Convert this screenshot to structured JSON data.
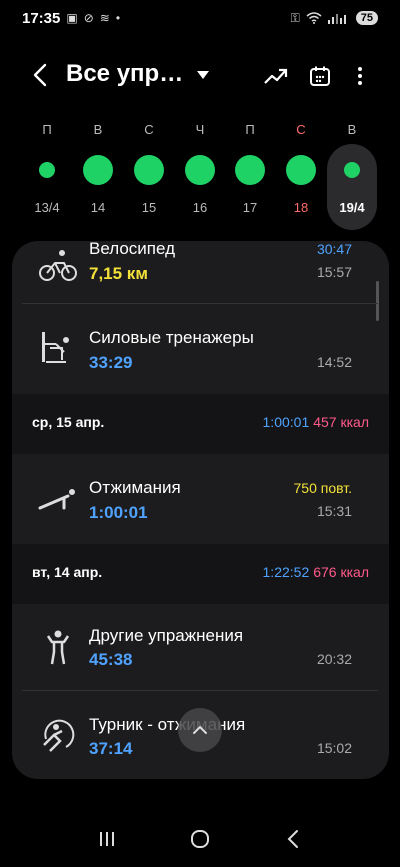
{
  "status": {
    "time": "17:35",
    "battery": "75",
    "icons": [
      "screenshot-icon",
      "link-icon",
      "wavy-icon",
      "dot-icon",
      "key-icon",
      "wifi-icon",
      "signal-icon"
    ]
  },
  "header": {
    "title": "Все упр…",
    "icons": [
      "back-icon",
      "dropdown-caret-icon",
      "trend-icon",
      "calendar-icon",
      "more-icon"
    ]
  },
  "week": {
    "accent_color": "#1fd266",
    "weekend_color": "#ff6b6b",
    "days": [
      {
        "letter": "П",
        "number": "13/4"
      },
      {
        "letter": "В",
        "number": "14"
      },
      {
        "letter": "С",
        "number": "15"
      },
      {
        "letter": "Ч",
        "number": "16"
      },
      {
        "letter": "П",
        "number": "17"
      },
      {
        "letter": "С",
        "number": "18"
      },
      {
        "letter": "В",
        "number": "19/4"
      }
    ],
    "selected_day": "19/4"
  },
  "entries": {
    "cycling": {
      "name": "Велосипед",
      "value": "7,15 км",
      "duration": "30:47",
      "time": "15:57",
      "icon": "bicycle-icon"
    },
    "machines": {
      "name": "Силовые тренажеры",
      "value": "33:29",
      "time": "14:52",
      "icon": "weight-machine-icon"
    },
    "pushups": {
      "name": "Отжимания",
      "value": "1:00:01",
      "reps": "750 повт.",
      "time": "15:31",
      "icon": "pushup-icon"
    },
    "other": {
      "name": "Другие упражнения",
      "value": "45:38",
      "time": "20:32",
      "icon": "person-exercise-icon"
    },
    "pullups": {
      "name": "Турник - отжимания",
      "value": "37:14",
      "time": "15:02",
      "icon": "pullup-icon"
    }
  },
  "groups": {
    "wed": {
      "date": "ср, 15 апр.",
      "duration": "1:00:01",
      "kcal": "457 ккал"
    },
    "tue": {
      "date": "вт, 14 апр.",
      "duration": "1:22:52",
      "kcal": "676 ккал"
    }
  },
  "colors": {
    "blue": "#4fa3ff",
    "yellow": "#f3e13a",
    "pink": "#ff5a8a",
    "panel": "#1c1c1e"
  },
  "nav": {
    "icons": [
      "recents-icon",
      "home-icon",
      "back-nav-icon"
    ]
  }
}
